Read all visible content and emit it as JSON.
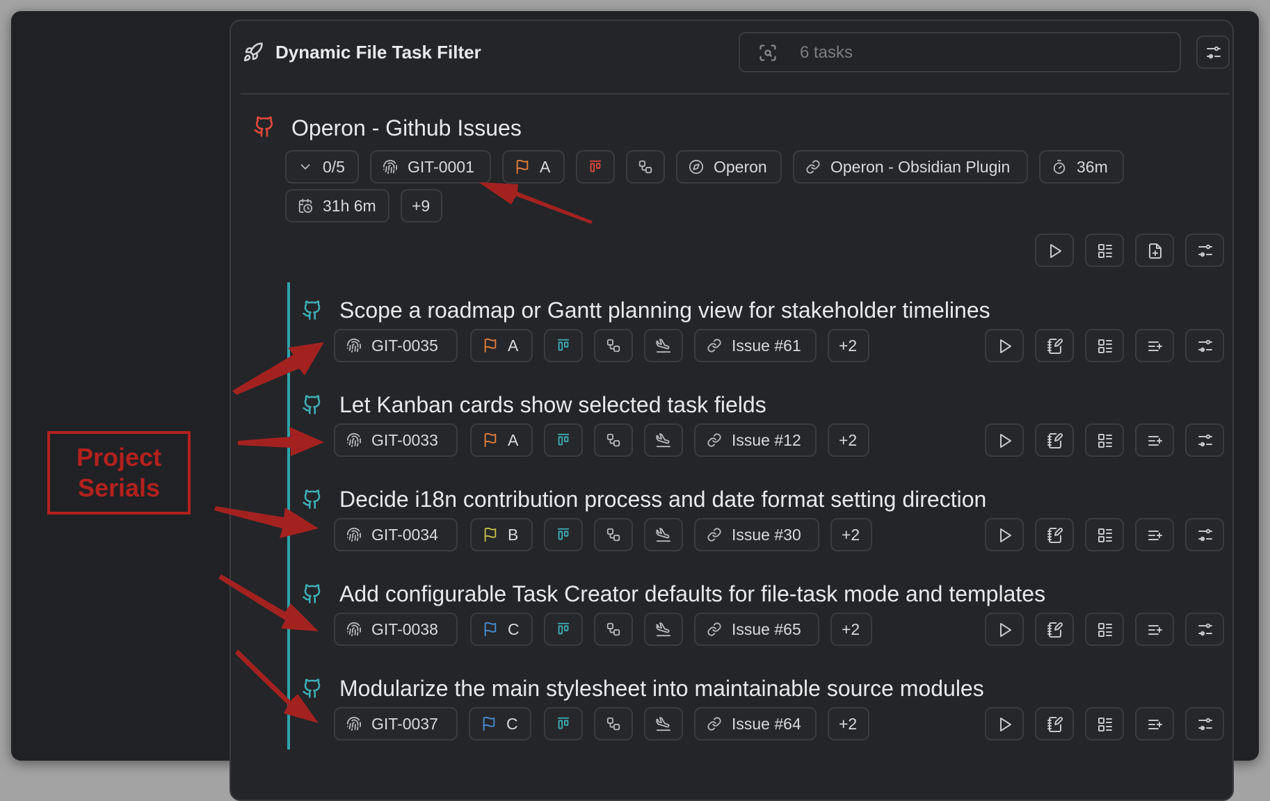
{
  "header": {
    "title": "Dynamic File Task Filter",
    "search_placeholder": "6 tasks"
  },
  "parent_task": {
    "title": "Operon - Github Issues",
    "progress": "0/5",
    "serial": "GIT-0001",
    "priority": "A",
    "area": "Operon",
    "project": "Operon - Obsidian Plugin",
    "estimate": "36m",
    "spent": "31h 6m",
    "more": "+9"
  },
  "tasks": [
    {
      "title": "Scope a roadmap or Gantt planning view for stakeholder timelines",
      "serial": "GIT-0035",
      "priority": "A",
      "priority_color": "#e8803a",
      "link": "Issue #61",
      "more": "+2"
    },
    {
      "title": "Let Kanban cards show selected task fields",
      "serial": "GIT-0033",
      "priority": "A",
      "priority_color": "#e8803a",
      "link": "Issue #12",
      "more": "+2"
    },
    {
      "title": "Decide i18n contribution process and date format setting direction",
      "serial": "GIT-0034",
      "priority": "B",
      "priority_color": "#c8c24a",
      "link": "Issue #30",
      "more": "+2"
    },
    {
      "title": "Add configurable Task Creator defaults for file-task mode and templates",
      "serial": "GIT-0038",
      "priority": "C",
      "priority_color": "#4a8fd6",
      "link": "Issue #65",
      "more": "+2"
    },
    {
      "title": "Modularize the main stylesheet into maintainable source modules",
      "serial": "GIT-0037",
      "priority": "C",
      "priority_color": "#4a8fd6",
      "link": "Issue #64",
      "more": "+2"
    }
  ],
  "annotation": {
    "line1": "Project",
    "line2": "Serials",
    "color": "#b3211e"
  },
  "colors": {
    "accent_teal": "#3fb0b9",
    "github_red": "#e04a3c",
    "background": "#202124"
  }
}
